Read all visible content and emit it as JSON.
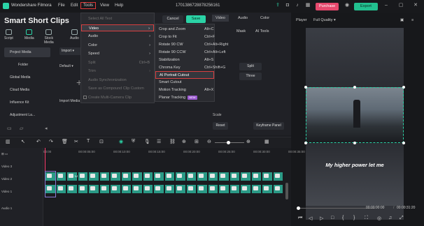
{
  "app": {
    "name": "Wondershare Filmora",
    "filename": "1701386728878256161"
  },
  "menubar": [
    "File",
    "Edit",
    "Tools",
    "View",
    "Help"
  ],
  "topbar": {
    "purchase": "Purchase",
    "export": "Export"
  },
  "project": {
    "title": "Smart Short Clips"
  },
  "toolbar_icons": [
    "Script",
    "Media",
    "Stock Media",
    "Audio"
  ],
  "sidebar": [
    "Project Media",
    "Folder",
    "Global Media",
    "Cloud Media",
    "Influence Kit",
    "Adjustment La..."
  ],
  "media": {
    "import": "Import",
    "default": "Default",
    "import_media": "Import Media"
  },
  "tools_menu": {
    "items": [
      {
        "label": "Select All Text",
        "dim": true
      },
      {
        "label": "Video",
        "arrow": true,
        "highlight": true
      },
      {
        "label": "Audio",
        "arrow": true
      },
      {
        "label": "Color",
        "arrow": true
      },
      {
        "label": "Speed",
        "arrow": true
      },
      {
        "label": "Split",
        "dim": true,
        "kb": "Ctrl+B"
      },
      {
        "label": "Trim",
        "dim": true,
        "arrow": true
      },
      {
        "label": "Audio Synchronization",
        "dim": true
      },
      {
        "label": "Save as Compound Clip Custom",
        "dim": true
      },
      {
        "label": "Create Multi-Camera Clip",
        "dim": true,
        "check": true
      }
    ]
  },
  "video_submenu": [
    {
      "label": "Crop and Zoom",
      "kb": "Alt+C"
    },
    {
      "label": "Crop to Fit",
      "kb": "Ctrl+F"
    },
    {
      "label": "Rotate 90 CW",
      "kb": "Ctrl+Alt+Right"
    },
    {
      "label": "Rotate 90 CCW",
      "kb": "Ctrl+Alt+Left"
    },
    {
      "label": "Stabilization",
      "kb": "Alt+S"
    },
    {
      "label": "Chroma Key",
      "kb": "Ctrl+Shift+G"
    },
    {
      "label": "AI Portrait Cutout",
      "kb": "",
      "highlight": true
    },
    {
      "label": "Smart Cutout",
      "kb": ""
    },
    {
      "label": "Motion Tracking",
      "kb": "Alt+X"
    },
    {
      "label": "Planar Tracking",
      "kb": "",
      "badge": "NEW"
    }
  ],
  "edit_panel": {
    "cancel": "Cancel",
    "save": "Save",
    "tabs": [
      "Video",
      "Audio",
      "Color"
    ],
    "subtabs": [
      "Mask",
      "AI Tools"
    ],
    "split": "Split",
    "three": "Three",
    "scale": "Scale",
    "reset": "Reset",
    "keyframe": "Keyframe Panel"
  },
  "player": {
    "label": "Player",
    "quality": "Full Quality",
    "caption": "My higher power let me",
    "time_current": "00:00:00:00",
    "time_total": "00:00:31:20"
  },
  "timeline": {
    "ruler": [
      "00:00",
      "00:00:05:00",
      "00:00:10:00",
      "00:00:15:00",
      "00:00:20:00",
      "00:00:25:00",
      "00:00:30:00",
      "00:00:35:00"
    ],
    "tracks": [
      "Video 3",
      "Video 2",
      "Video 1",
      "Audio 1"
    ],
    "clip_label": "Laug...",
    "clip_label2": "T"
  },
  "colors": {
    "accent": "#2bd3a6",
    "highlight_border": "#d84040",
    "purchase": "#e6496d"
  }
}
